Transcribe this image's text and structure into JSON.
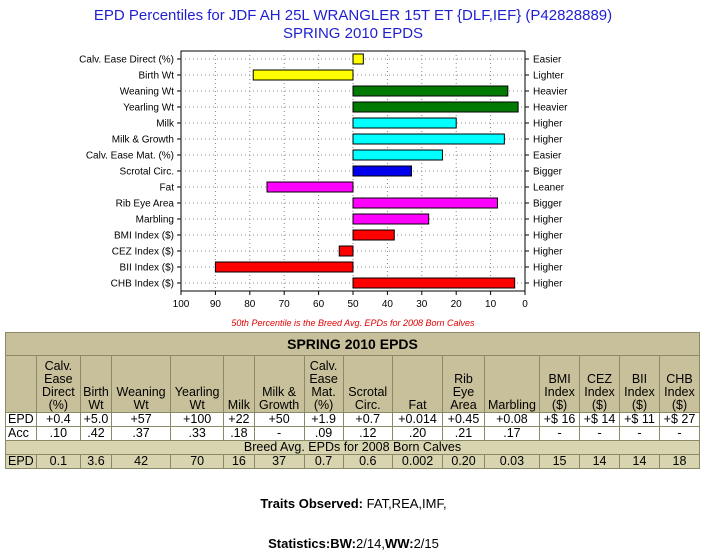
{
  "chart_data": {
    "type": "bar",
    "title": "EPD Percentiles for JDF AH 25L WRANGLER 15T ET {DLF,IEF} (P42828889)",
    "subtitle": "SPRING 2010 EPDS",
    "categories": [
      "Calv. Ease Direct (%)",
      "Birth Wt",
      "Weaning Wt",
      "Yearling Wt",
      "Milk",
      "Milk & Growth",
      "Calv. Ease Mat. (%)",
      "Scrotal Circ.",
      "Fat",
      "Rib Eye Area",
      "Marbling",
      "BMI Index ($)",
      "CEZ Index ($)",
      "BII Index ($)",
      "CHB Index ($)"
    ],
    "right_labels": [
      "Easier",
      "Lighter",
      "Heavier",
      "Heavier",
      "Higher",
      "Higher",
      "Easier",
      "Bigger",
      "Leaner",
      "Bigger",
      "Higher",
      "Higher",
      "Higher",
      "Higher",
      "Higher"
    ],
    "values": [
      47,
      79,
      5,
      2,
      20,
      6,
      24,
      33,
      75,
      8,
      28,
      38,
      54,
      90,
      3
    ],
    "baseline": 50,
    "colors": [
      "#ffff00",
      "#ffff00",
      "#007a00",
      "#007a00",
      "#00ffff",
      "#00ffff",
      "#00ffff",
      "#0000ee",
      "#ff00ff",
      "#ff00ff",
      "#ff00ff",
      "#ff0000",
      "#ff0000",
      "#ff0000",
      "#ff0000"
    ],
    "x_ticks": [
      "100",
      "90",
      "80",
      "70",
      "60",
      "50",
      "40",
      "30",
      "20",
      "10",
      "0"
    ],
    "xlim": [
      100,
      0
    ],
    "grid": true,
    "note": "50th Percentile is the Breed Avg. EPDs for 2008 Born Calves"
  },
  "table": {
    "title": "SPRING 2010 EPDS",
    "headers": [
      "Calv. Ease Direct (%)",
      "Birth Wt",
      "Weaning Wt",
      "Yearling Wt",
      "Milk",
      "Milk & Growth",
      "Calv. Ease Mat. (%)",
      "Scrotal Circ.",
      "Fat",
      "Rib Eye Area",
      "Marbling",
      "BMI Index ($)",
      "CEZ Index ($)",
      "BII Index ($)",
      "CHB Index ($)"
    ],
    "epd_label": "EPD",
    "epd": [
      "+0.4",
      "+5.0",
      "+57",
      "+100",
      "+22",
      "+50",
      "+1.9",
      "+0.7",
      "+0.014",
      "+0.45",
      "+0.08",
      "+$ 16",
      "+$ 14",
      "+$ 11",
      "+$ 27"
    ],
    "acc_label": "Acc",
    "acc": [
      ".10",
      ".42",
      ".37",
      ".33",
      ".18",
      "-",
      ".09",
      ".12",
      ".20",
      ".21",
      ".17",
      "-",
      "-",
      "-",
      "-"
    ],
    "avg_title": "Breed Avg. EPDs for 2008 Born Calves",
    "avg_label": "EPD",
    "avg": [
      "0.1",
      "3.6",
      "42",
      "70",
      "16",
      "37",
      "0.7",
      "0.6",
      "0.002",
      "0.20",
      "0.03",
      "15",
      "14",
      "14",
      "18"
    ]
  },
  "footer": {
    "traits_label": "Traits Observed:",
    "traits_value": "FAT,REA,IMF,",
    "stats_label": "Statistics:",
    "stats_bw_label": "BW:",
    "stats_bw_value": "2/14",
    "stats_sep": ",",
    "stats_ww_label": "WW:",
    "stats_ww_value": "2/15"
  }
}
